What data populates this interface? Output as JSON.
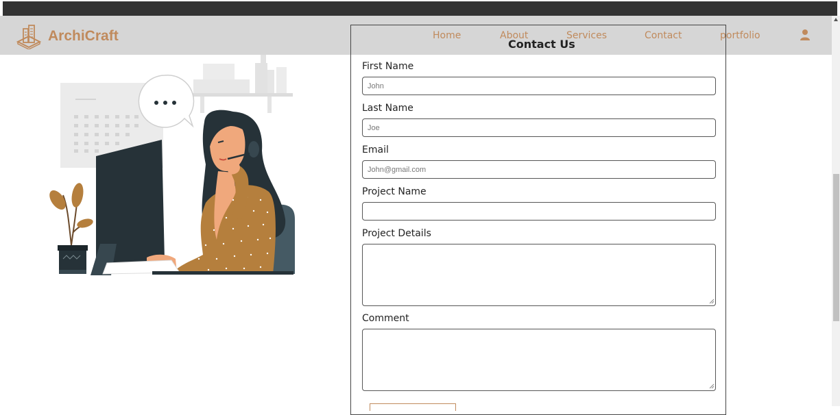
{
  "brand": {
    "name": "ArchiCraft"
  },
  "nav": {
    "items": [
      "Home",
      "About",
      "Services",
      "Contact",
      "portfolio"
    ]
  },
  "form": {
    "title": "Contact Us",
    "first_name": {
      "label": "First Name",
      "placeholder": "John"
    },
    "last_name": {
      "label": "Last Name",
      "placeholder": "Joe"
    },
    "email": {
      "label": "Email",
      "placeholder": "John@gmail.com"
    },
    "project_name": {
      "label": "Project Name",
      "placeholder": ""
    },
    "project_details": {
      "label": "Project Details"
    },
    "comment": {
      "label": "Comment"
    }
  },
  "colors": {
    "accent": "#c08a5c",
    "navbar_bg": "#d6d6d6",
    "topbar_bg": "#333333",
    "text": "#222222"
  },
  "icons": {
    "logo": "building-logo-icon",
    "user": "user-icon",
    "more": "ellipsis-icon"
  }
}
